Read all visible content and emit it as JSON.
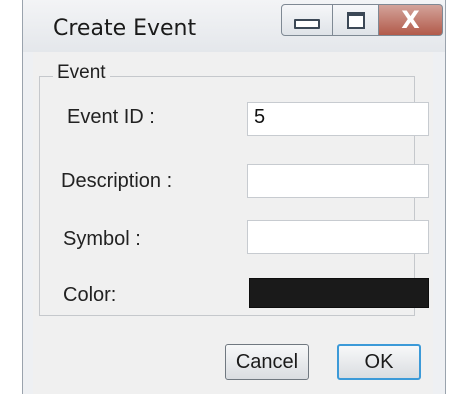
{
  "window": {
    "title": "Create Event",
    "controls": {
      "minimize_icon": "minimize-icon",
      "maximize_icon": "maximize-icon",
      "close_icon": "close-icon",
      "close_glyph": "X"
    }
  },
  "group": {
    "label": "Event"
  },
  "fields": {
    "event_id": {
      "label": "Event ID :",
      "value": "5"
    },
    "description": {
      "label": "Description :",
      "value": ""
    },
    "symbol": {
      "label": "Symbol :",
      "value": ""
    },
    "color": {
      "label": "Color:",
      "value": "#1a1a1a"
    }
  },
  "buttons": {
    "cancel": "Cancel",
    "ok": "OK"
  }
}
